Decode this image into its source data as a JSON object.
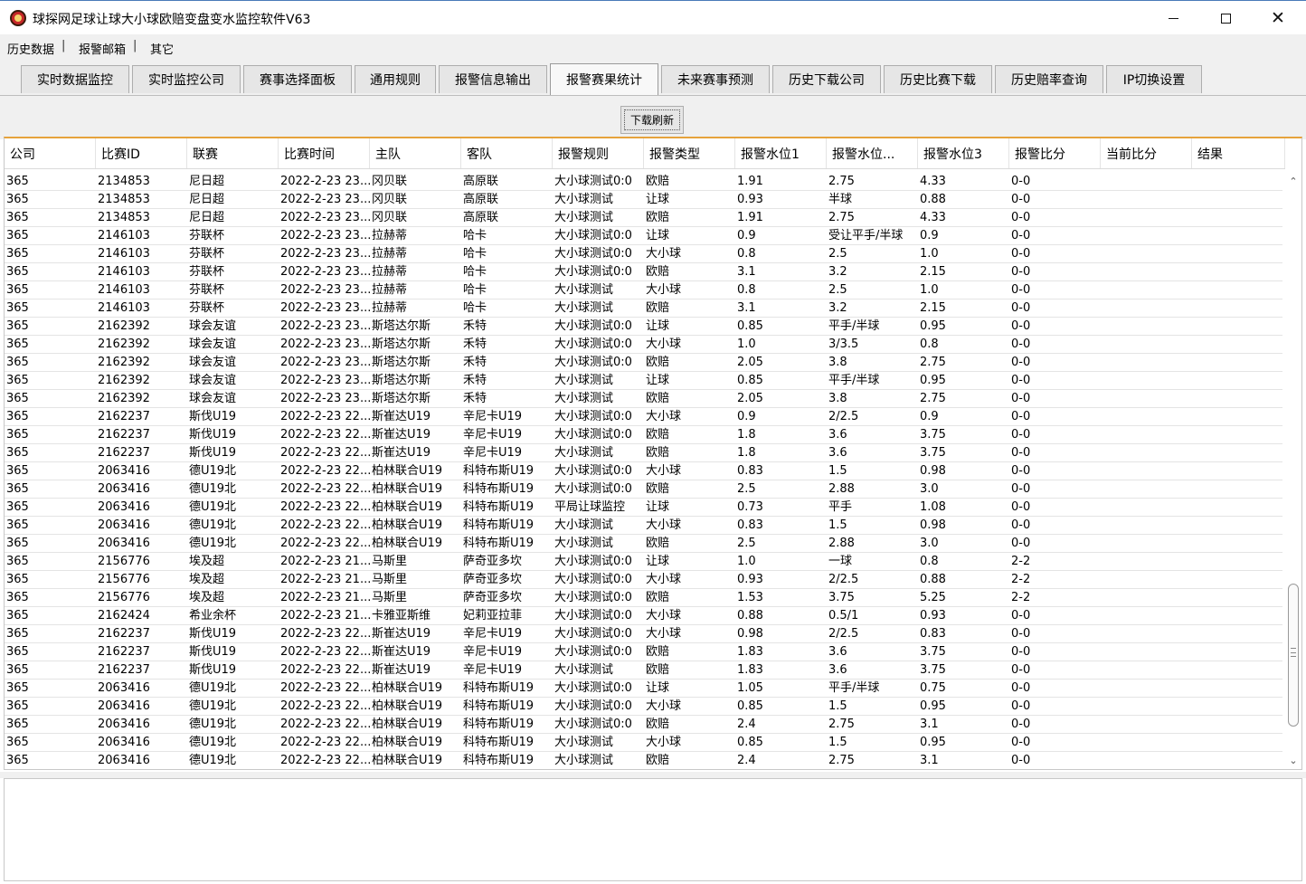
{
  "window": {
    "title": "球探网足球让球大小球欧赔变盘变水监控软件V63",
    "minimize": "",
    "maximize": "",
    "close": "✕"
  },
  "menu": [
    "历史数据",
    "报警邮箱",
    "其它"
  ],
  "menu_separator": "|",
  "tabs": [
    {
      "label": "实时数据监控"
    },
    {
      "label": "实时监控公司"
    },
    {
      "label": "赛事选择面板"
    },
    {
      "label": "通用规则"
    },
    {
      "label": "报警信息输出"
    },
    {
      "label": "报警赛果统计",
      "active": true
    },
    {
      "label": "未来赛事预测"
    },
    {
      "label": "历史下载公司"
    },
    {
      "label": "历史比赛下载"
    },
    {
      "label": "历史赔率查询"
    },
    {
      "label": "IP切换设置"
    }
  ],
  "toolbar": {
    "refresh_label": "下载刷新"
  },
  "table": {
    "columns": [
      "公司",
      "比赛ID",
      "联赛",
      "比赛时间",
      "主队",
      "客队",
      "报警规则",
      "报警类型",
      "报警水位1",
      "报警水位...",
      "报警水位3",
      "报警比分",
      "当前比分",
      "结果"
    ],
    "rows": [
      [
        "365",
        "2134853",
        "尼日超",
        "2022-2-23 23...",
        "冈贝联",
        "高原联",
        "大小球测试0:0",
        "欧赔",
        "1.91",
        "2.75",
        "4.33",
        "0-0",
        "",
        ""
      ],
      [
        "365",
        "2134853",
        "尼日超",
        "2022-2-23 23...",
        "冈贝联",
        "高原联",
        "大小球测试",
        "让球",
        "0.93",
        "半球",
        "0.88",
        "0-0",
        "",
        ""
      ],
      [
        "365",
        "2134853",
        "尼日超",
        "2022-2-23 23...",
        "冈贝联",
        "高原联",
        "大小球测试",
        "欧赔",
        "1.91",
        "2.75",
        "4.33",
        "0-0",
        "",
        ""
      ],
      [
        "365",
        "2146103",
        "芬联杯",
        "2022-2-23 23...",
        "拉赫蒂",
        "哈卡",
        "大小球测试0:0",
        "让球",
        "0.9",
        "受让平手/半球",
        "0.9",
        "0-0",
        "",
        ""
      ],
      [
        "365",
        "2146103",
        "芬联杯",
        "2022-2-23 23...",
        "拉赫蒂",
        "哈卡",
        "大小球测试0:0",
        "大小球",
        "0.8",
        "2.5",
        "1.0",
        "0-0",
        "",
        ""
      ],
      [
        "365",
        "2146103",
        "芬联杯",
        "2022-2-23 23...",
        "拉赫蒂",
        "哈卡",
        "大小球测试0:0",
        "欧赔",
        "3.1",
        "3.2",
        "2.15",
        "0-0",
        "",
        ""
      ],
      [
        "365",
        "2146103",
        "芬联杯",
        "2022-2-23 23...",
        "拉赫蒂",
        "哈卡",
        "大小球测试",
        "大小球",
        "0.8",
        "2.5",
        "1.0",
        "0-0",
        "",
        ""
      ],
      [
        "365",
        "2146103",
        "芬联杯",
        "2022-2-23 23...",
        "拉赫蒂",
        "哈卡",
        "大小球测试",
        "欧赔",
        "3.1",
        "3.2",
        "2.15",
        "0-0",
        "",
        ""
      ],
      [
        "365",
        "2162392",
        "球会友谊",
        "2022-2-23 23...",
        "斯塔达尔斯",
        "禾特",
        "大小球测试0:0",
        "让球",
        "0.85",
        "平手/半球",
        "0.95",
        "0-0",
        "",
        ""
      ],
      [
        "365",
        "2162392",
        "球会友谊",
        "2022-2-23 23...",
        "斯塔达尔斯",
        "禾特",
        "大小球测试0:0",
        "大小球",
        "1.0",
        "3/3.5",
        "0.8",
        "0-0",
        "",
        ""
      ],
      [
        "365",
        "2162392",
        "球会友谊",
        "2022-2-23 23...",
        "斯塔达尔斯",
        "禾特",
        "大小球测试0:0",
        "欧赔",
        "2.05",
        "3.8",
        "2.75",
        "0-0",
        "",
        ""
      ],
      [
        "365",
        "2162392",
        "球会友谊",
        "2022-2-23 23...",
        "斯塔达尔斯",
        "禾特",
        "大小球测试",
        "让球",
        "0.85",
        "平手/半球",
        "0.95",
        "0-0",
        "",
        ""
      ],
      [
        "365",
        "2162392",
        "球会友谊",
        "2022-2-23 23...",
        "斯塔达尔斯",
        "禾特",
        "大小球测试",
        "欧赔",
        "2.05",
        "3.8",
        "2.75",
        "0-0",
        "",
        ""
      ],
      [
        "365",
        "2162237",
        "斯伐U19",
        "2022-2-23 22...",
        "斯崔达U19",
        "辛尼卡U19",
        "大小球测试0:0",
        "大小球",
        "0.9",
        "2/2.5",
        "0.9",
        "0-0",
        "",
        ""
      ],
      [
        "365",
        "2162237",
        "斯伐U19",
        "2022-2-23 22...",
        "斯崔达U19",
        "辛尼卡U19",
        "大小球测试0:0",
        "欧赔",
        "1.8",
        "3.6",
        "3.75",
        "0-0",
        "",
        ""
      ],
      [
        "365",
        "2162237",
        "斯伐U19",
        "2022-2-23 22...",
        "斯崔达U19",
        "辛尼卡U19",
        "大小球测试",
        "欧赔",
        "1.8",
        "3.6",
        "3.75",
        "0-0",
        "",
        ""
      ],
      [
        "365",
        "2063416",
        "德U19北",
        "2022-2-23 22...",
        "柏林联合U19",
        "科特布斯U19",
        "大小球测试0:0",
        "大小球",
        "0.83",
        "1.5",
        "0.98",
        "0-0",
        "",
        ""
      ],
      [
        "365",
        "2063416",
        "德U19北",
        "2022-2-23 22...",
        "柏林联合U19",
        "科特布斯U19",
        "大小球测试0:0",
        "欧赔",
        "2.5",
        "2.88",
        "3.0",
        "0-0",
        "",
        ""
      ],
      [
        "365",
        "2063416",
        "德U19北",
        "2022-2-23 22...",
        "柏林联合U19",
        "科特布斯U19",
        "平局让球监控",
        "让球",
        "0.73",
        "平手",
        "1.08",
        "0-0",
        "",
        ""
      ],
      [
        "365",
        "2063416",
        "德U19北",
        "2022-2-23 22...",
        "柏林联合U19",
        "科特布斯U19",
        "大小球测试",
        "大小球",
        "0.83",
        "1.5",
        "0.98",
        "0-0",
        "",
        ""
      ],
      [
        "365",
        "2063416",
        "德U19北",
        "2022-2-23 22...",
        "柏林联合U19",
        "科特布斯U19",
        "大小球测试",
        "欧赔",
        "2.5",
        "2.88",
        "3.0",
        "0-0",
        "",
        ""
      ],
      [
        "365",
        "2156776",
        "埃及超",
        "2022-2-23 21...",
        "马斯里",
        "萨奇亚多坎",
        "大小球测试0:0",
        "让球",
        "1.0",
        "一球",
        "0.8",
        "2-2",
        "",
        ""
      ],
      [
        "365",
        "2156776",
        "埃及超",
        "2022-2-23 21...",
        "马斯里",
        "萨奇亚多坎",
        "大小球测试0:0",
        "大小球",
        "0.93",
        "2/2.5",
        "0.88",
        "2-2",
        "",
        ""
      ],
      [
        "365",
        "2156776",
        "埃及超",
        "2022-2-23 21...",
        "马斯里",
        "萨奇亚多坎",
        "大小球测试0:0",
        "欧赔",
        "1.53",
        "3.75",
        "5.25",
        "2-2",
        "",
        ""
      ],
      [
        "365",
        "2162424",
        "希业余杯",
        "2022-2-23 21...",
        "卡雅亚斯维",
        "妃莉亚拉菲",
        "大小球测试0:0",
        "大小球",
        "0.88",
        "0.5/1",
        "0.93",
        "0-0",
        "",
        ""
      ],
      [
        "365",
        "2162237",
        "斯伐U19",
        "2022-2-23 22...",
        "斯崔达U19",
        "辛尼卡U19",
        "大小球测试0:0",
        "大小球",
        "0.98",
        "2/2.5",
        "0.83",
        "0-0",
        "",
        ""
      ],
      [
        "365",
        "2162237",
        "斯伐U19",
        "2022-2-23 22...",
        "斯崔达U19",
        "辛尼卡U19",
        "大小球测试0:0",
        "欧赔",
        "1.83",
        "3.6",
        "3.75",
        "0-0",
        "",
        ""
      ],
      [
        "365",
        "2162237",
        "斯伐U19",
        "2022-2-23 22...",
        "斯崔达U19",
        "辛尼卡U19",
        "大小球测试",
        "欧赔",
        "1.83",
        "3.6",
        "3.75",
        "0-0",
        "",
        ""
      ],
      [
        "365",
        "2063416",
        "德U19北",
        "2022-2-23 22...",
        "柏林联合U19",
        "科特布斯U19",
        "大小球测试0:0",
        "让球",
        "1.05",
        "平手/半球",
        "0.75",
        "0-0",
        "",
        ""
      ],
      [
        "365",
        "2063416",
        "德U19北",
        "2022-2-23 22...",
        "柏林联合U19",
        "科特布斯U19",
        "大小球测试0:0",
        "大小球",
        "0.85",
        "1.5",
        "0.95",
        "0-0",
        "",
        ""
      ],
      [
        "365",
        "2063416",
        "德U19北",
        "2022-2-23 22...",
        "柏林联合U19",
        "科特布斯U19",
        "大小球测试0:0",
        "欧赔",
        "2.4",
        "2.75",
        "3.1",
        "0-0",
        "",
        ""
      ],
      [
        "365",
        "2063416",
        "德U19北",
        "2022-2-23 22...",
        "柏林联合U19",
        "科特布斯U19",
        "大小球测试",
        "大小球",
        "0.85",
        "1.5",
        "0.95",
        "0-0",
        "",
        ""
      ],
      [
        "365",
        "2063416",
        "德U19北",
        "2022-2-23 22...",
        "柏林联合U19",
        "科特布斯U19",
        "大小球测试",
        "欧赔",
        "2.4",
        "2.75",
        "3.1",
        "0-0",
        "",
        ""
      ]
    ]
  },
  "scrollbar": {
    "up_arrow": "⌃",
    "down_arrow": "⌄"
  },
  "log_output": ""
}
